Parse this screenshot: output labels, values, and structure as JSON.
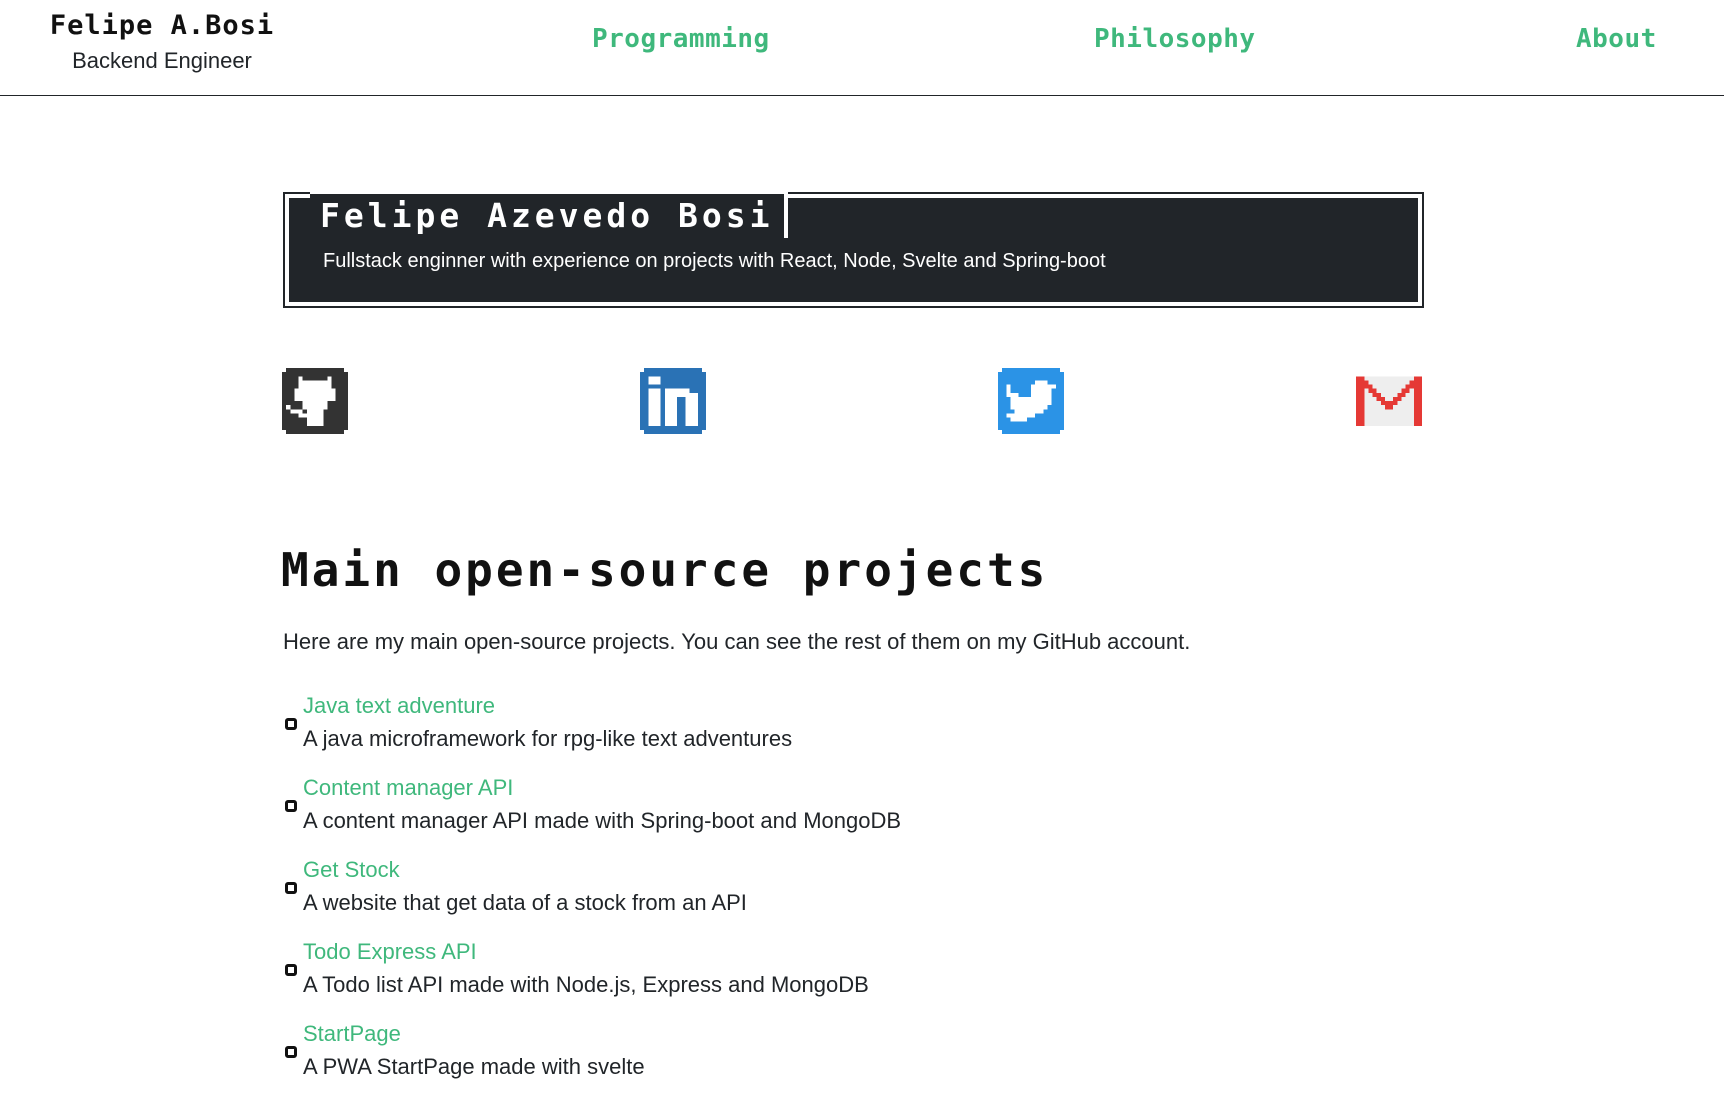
{
  "header": {
    "brand_name": "Felipe A.Bosi",
    "brand_role": "Backend Engineer",
    "nav": [
      {
        "label": "Programming"
      },
      {
        "label": "Philosophy"
      },
      {
        "label": "About"
      }
    ]
  },
  "intro": {
    "title": "Felipe Azevedo Bosi",
    "description": "Fullstack enginner with experience on projects with React, Node, Svelte and Spring-boot"
  },
  "social": [
    {
      "icon": "github-icon",
      "color": "#333333"
    },
    {
      "icon": "linkedin-icon",
      "color": "#2a72b5"
    },
    {
      "icon": "twitter-icon",
      "color": "#2b93e6"
    },
    {
      "icon": "gmail-icon",
      "color": "#e53935"
    }
  ],
  "projects_section": {
    "title": "Main open-source projects",
    "intro": "Here are my main open-source projects. You can see the rest of them on my GitHub account.",
    "items": [
      {
        "name": "Java text adventure",
        "description": "A java microframework for rpg-like text adventures"
      },
      {
        "name": "Content manager API",
        "description": "A content manager API made with Spring-boot and MongoDB"
      },
      {
        "name": "Get Stock",
        "description": "A website that get data of a stock from an API"
      },
      {
        "name": "Todo Express API",
        "description": "A Todo list API made with Node.js, Express and MongoDB"
      },
      {
        "name": "StartPage",
        "description": "A PWA StartPage made with svelte"
      }
    ]
  },
  "colors": {
    "accent": "#3fb87c",
    "dark": "#212529"
  }
}
